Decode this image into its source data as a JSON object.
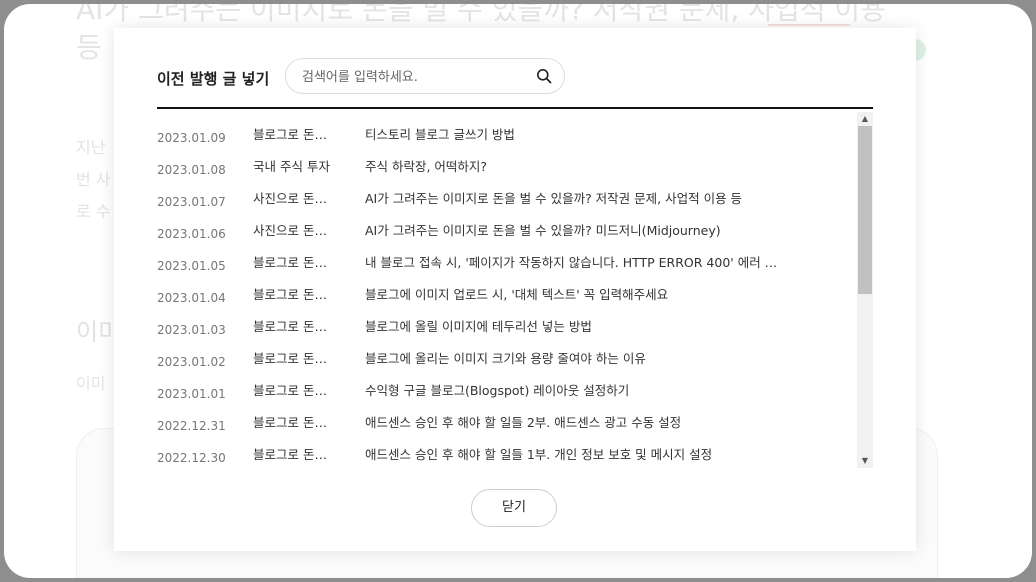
{
  "background": {
    "title_line1": "AI가 그려주는 이미지로 돈을 벌 수 있을까? 저작권 문제, 사업적 이용",
    "title_line2": "등",
    "para_line1": "지난",
    "para_line2": "번 사",
    "para_line3": "로 수",
    "heading": "이미",
    "subtext": "이미"
  },
  "modal": {
    "title": "이전 발행 글 넣기",
    "search": {
      "placeholder": "검색어를 입력하세요.",
      "value": ""
    },
    "posts": [
      {
        "date": "2023.01.09",
        "category": "블로그로 돈…",
        "title": "티스토리 블로그 글쓰기 방법"
      },
      {
        "date": "2023.01.08",
        "category": "국내 주식 투자",
        "title": "주식 하락장, 어떡하지?"
      },
      {
        "date": "2023.01.07",
        "category": "사진으로 돈…",
        "title": "AI가 그려주는 이미지로 돈을 벌 수 있을까? 저작권 문제, 사업적 이용 등"
      },
      {
        "date": "2023.01.06",
        "category": "사진으로 돈…",
        "title": "AI가 그려주는 이미지로 돈을 벌 수 있을까? 미드저니(Midjourney)"
      },
      {
        "date": "2023.01.05",
        "category": "블로그로 돈…",
        "title": "내 블로그 접속 시, '페이지가 작동하지 않습니다. HTTP ERROR 400' 에러 …"
      },
      {
        "date": "2023.01.04",
        "category": "블로그로 돈…",
        "title": "블로그에 이미지 업로드 시, '대체 텍스트' 꼭 입력해주세요"
      },
      {
        "date": "2023.01.03",
        "category": "블로그로 돈…",
        "title": "블로그에 올릴 이미지에 테두리선 넣는 방법"
      },
      {
        "date": "2023.01.02",
        "category": "블로그로 돈…",
        "title": "블로그에 올리는 이미지 크기와 용량 줄여야 하는 이유"
      },
      {
        "date": "2023.01.01",
        "category": "블로그로 돈…",
        "title": "수익형 구글 블로그(Blogspot) 레이아웃 설정하기"
      },
      {
        "date": "2022.12.31",
        "category": "블로그로 돈…",
        "title": "애드센스 승인 후 해야 할 일들 2부. 애드센스 광고 수동 설정"
      },
      {
        "date": "2022.12.30",
        "category": "블로그로 돈…",
        "title": "애드센스 승인 후 해야 할 일들 1부. 개인 정보 보호 및 메시지 설정"
      }
    ],
    "close_label": "닫기"
  },
  "icons": {
    "search": "search-icon",
    "scroll_up": "scroll-up-arrow-icon",
    "scroll_down": "scroll-down-arrow-icon"
  }
}
